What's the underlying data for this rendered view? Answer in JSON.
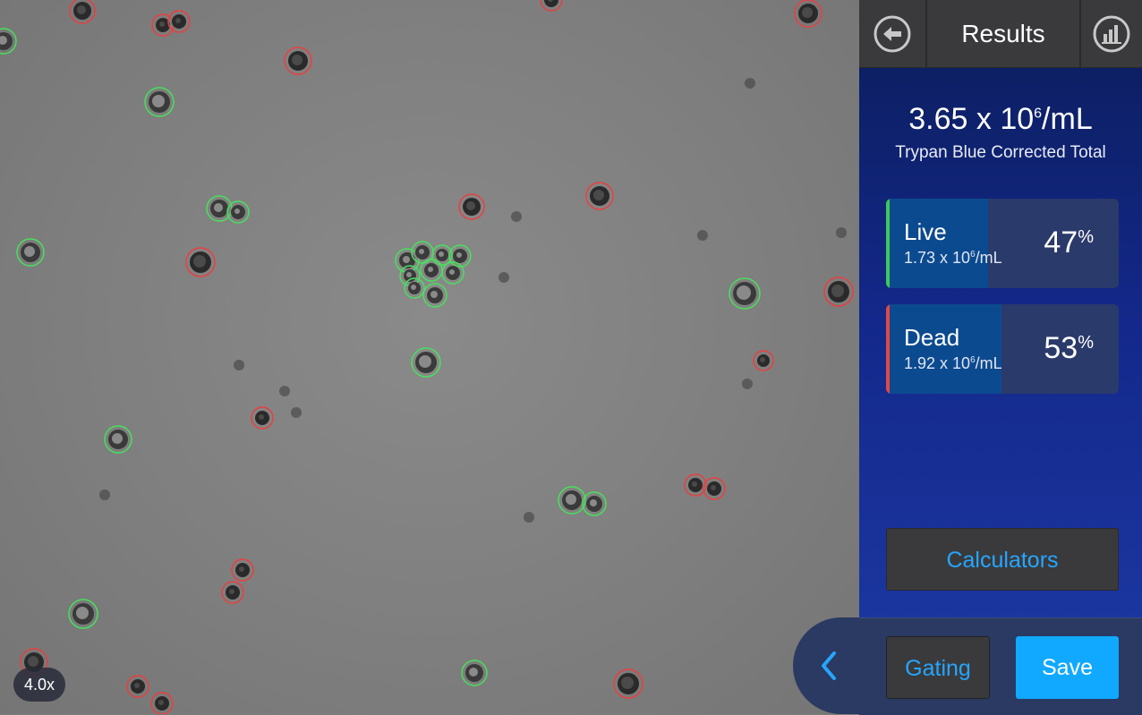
{
  "image_view": {
    "zoom_label": "4.0x"
  },
  "header": {
    "title": "Results",
    "back_icon": "back-arrow-icon",
    "chart_icon": "bar-chart-icon"
  },
  "summary": {
    "total_mantissa": "3.65 x 10",
    "total_exponent": "6",
    "total_unit": "/mL",
    "total_label": "Trypan Blue Corrected Total"
  },
  "live": {
    "label": "Live",
    "conc_mantissa": "1.73 x 10",
    "conc_exponent": "6",
    "conc_unit": "/mL",
    "percent": "47",
    "percent_sign": "%",
    "fraction": 0.47,
    "color": "#3ec85a"
  },
  "dead": {
    "label": "Dead",
    "conc_mantissa": "1.92 x 10",
    "conc_exponent": "6",
    "conc_unit": "/mL",
    "percent": "53",
    "percent_sign": "%",
    "fraction": 0.53,
    "color": "#e04848"
  },
  "buttons": {
    "calculators": "Calculators",
    "gating": "Gating",
    "save": "Save"
  },
  "colors": {
    "accent": "#26a6ff",
    "save": "#10a9ff",
    "live_outline": "#48e05c",
    "dead_outline": "#e84040"
  }
}
